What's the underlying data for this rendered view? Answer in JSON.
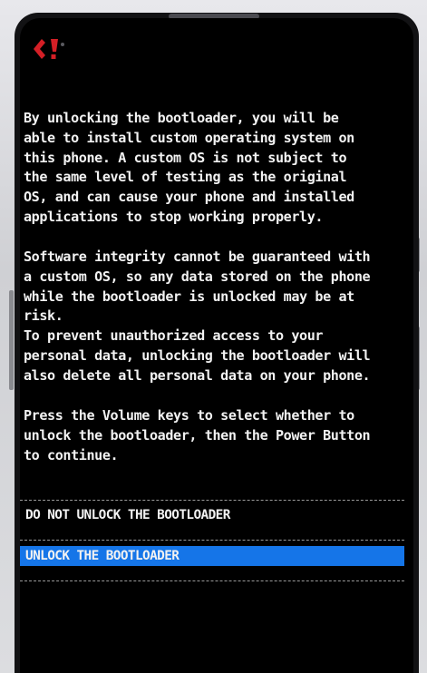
{
  "message": {
    "paragraph_1": "By unlocking the bootloader, you will be\nable to install custom operating system on\nthis phone. A custom OS is not subject to\nthe same level of testing as the original\nOS, and can cause your phone and installed\napplications to stop working properly.",
    "paragraph_2": "Software integrity cannot be guaranteed with\na custom OS, so any data stored on the phone\nwhile the bootloader is unlocked may be at\nrisk.\nTo prevent unauthorized access to your\npersonal data, unlocking the bootloader will\nalso delete all personal data on your phone.",
    "paragraph_3": "Press the Volume keys to select whether to\nunlock the bootloader, then the Power Button\nto continue."
  },
  "options": [
    {
      "label": "DO NOT UNLOCK THE BOOTLOADER",
      "selected": false
    },
    {
      "label": "UNLOCK THE BOOTLOADER",
      "selected": true
    }
  ],
  "colors": {
    "background": "#000000",
    "text": "#f2f2f2",
    "selection": "#1575e8",
    "logo": "#d41f26"
  },
  "icons": {
    "logo": "brand-logo-icon"
  }
}
